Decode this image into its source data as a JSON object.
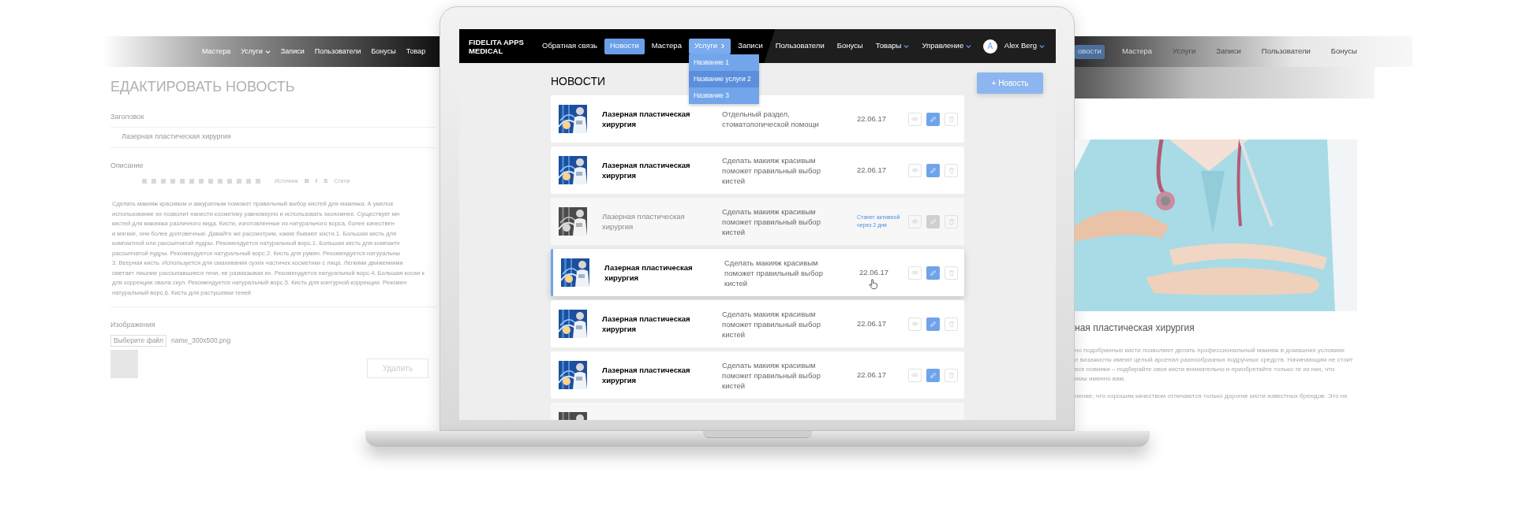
{
  "side_left": {
    "nav": [
      {
        "label": "Мастера",
        "dropdown": false
      },
      {
        "label": "Услуги",
        "dropdown": true
      },
      {
        "label": "Записи",
        "dropdown": false
      },
      {
        "label": "Пользователи",
        "dropdown": false
      },
      {
        "label": "Бонусы",
        "dropdown": false
      },
      {
        "label": "Товар",
        "dropdown": false
      }
    ],
    "title": "ЕДАКТИРОВАТЬ НОВОСТЬ",
    "field_label": "Заголовок",
    "field_value": "Лазерная пластическая хирургия",
    "editor_label": "Описание",
    "toolbar": [
      "Источник",
      "B",
      "I",
      "S",
      "Стили"
    ],
    "text_lines": [
      "Сделать макияж красивым и аккуратным поможет правильный выбор кистей для макияжа. А умелое",
      "использование их позволит нанести косметику равномерно и использовать экономнее. Существует мн",
      "кистей для макияжа различного вида. Кисти, изготовленные из натурального ворса, более качествен",
      "и мягкие, они более долговечные. Давайте же рассмотрим, какие бывают кисти.1. Большая кисть для",
      "компактной или рассыпчатой пудры. Рекомендуется натуральный ворс.1. Большая кисть для компактн",
      "рассыпчатой пудры. Рекомендуется натуральный ворс.2. Кисть для румян. Рекомендуется натуральны",
      "3. Веерная кисть. Используется для смахивания сухих частичек косметики с лица. Легкими движениями",
      "сметает лишние рассыпавшиеся тени, не размазывая их. Рекомендуется натуральный ворс.4. Большая косая к",
      "для коррекции овала скул. Рекомендуется натуральный ворс.5. Кисть для контурной коррекции. Рекомен",
      "натуральный ворс.6. Кисть для растушевки теней"
    ],
    "images_label": "Изображения",
    "file_button": "Выберите файл",
    "file_name": "name_300x500.png",
    "delete_button": "Удалить"
  },
  "app": {
    "logo": "FIDELITA APPS MEDICAL",
    "nav": [
      {
        "label": "Обратная связь",
        "selected": false,
        "dropdown": false,
        "expanded": false
      },
      {
        "label": "Новости",
        "selected": true,
        "dropdown": false,
        "expanded": false
      },
      {
        "label": "Мастера",
        "selected": false,
        "dropdown": false,
        "expanded": false
      },
      {
        "label": "Услуги",
        "selected": false,
        "dropdown": true,
        "expanded": true
      },
      {
        "label": "Записи",
        "selected": false,
        "dropdown": false,
        "expanded": false
      },
      {
        "label": "Пользователи",
        "selected": false,
        "dropdown": false,
        "expanded": false
      },
      {
        "label": "Бонусы",
        "selected": false,
        "dropdown": false,
        "expanded": false
      },
      {
        "label": "Товары",
        "selected": false,
        "dropdown": true,
        "expanded": false
      },
      {
        "label": "Управление",
        "selected": false,
        "dropdown": true,
        "expanded": false
      }
    ],
    "submenu": [
      {
        "label": "Название 1",
        "selected": false
      },
      {
        "label": "Название услуги 2",
        "selected": true
      },
      {
        "label": "Название 3",
        "selected": false
      }
    ],
    "user": {
      "initial": "A",
      "name": "Alex Berg"
    },
    "page_title": "НОВОСТИ",
    "add_button": "+ Новость",
    "rows": [
      {
        "title": "Лазерная пластическая хирургия",
        "description": "Отдельный раздел, стоматологической помощи",
        "date": "22.06.17",
        "active": true,
        "selected": false
      },
      {
        "title": "Лазерная пластическая хирургия",
        "description": "Сделать макияж красивым поможет правильный выбор кистей",
        "date": "22.06.17",
        "active": true,
        "selected": false
      },
      {
        "title": "Лазерная пластическая хирургия",
        "description": "Сделать макияж красивым поможет правильный выбор кистей",
        "status": "Станет активной через 2 дня",
        "active": false,
        "selected": false
      },
      {
        "title": "Лазерная пластическая хирургия",
        "description": "Сделать макияж красивым поможет правильный выбор кистей",
        "date": "22.06.17",
        "active": true,
        "selected": true
      },
      {
        "title": "Лазерная пластическая хирургия",
        "description": "Сделать макияж красивым поможет правильный выбор кистей",
        "date": "22.06.17",
        "active": true,
        "selected": false
      },
      {
        "title": "Лазерная пластическая хирургия",
        "description": "Сделать макияж красивым поможет правильный выбор кистей",
        "date": "22.06.17",
        "active": true,
        "selected": false
      },
      {
        "active": false,
        "selected": false
      }
    ]
  },
  "side_right": {
    "nav": [
      {
        "label": "овости",
        "selected": true
      },
      {
        "label": "Мастера",
        "selected": false
      },
      {
        "label": "Услуги",
        "selected": false
      },
      {
        "label": "Записи",
        "selected": false
      },
      {
        "label": "Пользователи",
        "selected": false
      },
      {
        "label": "Бонусы",
        "selected": false
      }
    ],
    "title": "ная пластическая хирургия",
    "text_lines": [
      "но подобранные кисти позволяют делать профессиональный макияж в домашних условиях",
      "е визажисты имеют целый арсенал разнообразных подручных средств. Начинающим не стоит",
      "все новинки – подбирайте свои кисти внимательно и приобретайте только те из них, что",
      "имы именно вам.",
      "нение, что хорошим качеством отличаются только дорогие кисти известных брендов. Это не"
    ]
  }
}
